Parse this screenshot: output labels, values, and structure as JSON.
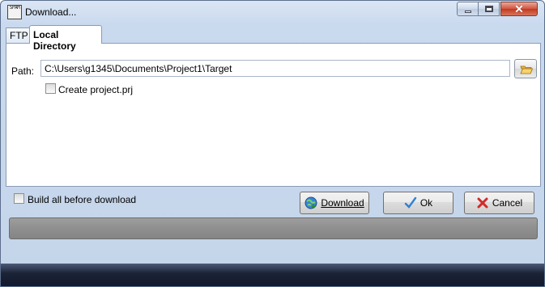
{
  "window": {
    "title": "Download...",
    "app_icon_text": "SPAM",
    "controls": {
      "minimize": "minimize-icon",
      "maximize": "maximize-icon",
      "close": "close-icon"
    }
  },
  "tabs": [
    {
      "label": "FTP",
      "active": false
    },
    {
      "label": "Local Directory",
      "active": true
    }
  ],
  "local_directory": {
    "path_label": "Path:",
    "path_value": "C:\\Users\\g1345\\Documents\\Project1\\Target",
    "browse_icon": "folder-open-icon",
    "create_project_label": "Create project.prj",
    "create_project_checked": false
  },
  "footer": {
    "build_all_label": "Build all before download",
    "build_all_checked": false,
    "download_label": "Download",
    "download_icon": "globe-download-icon",
    "ok_label": "Ok",
    "ok_icon": "checkmark-icon",
    "cancel_label": "Cancel",
    "cancel_icon": "red-x-icon",
    "progress": 0
  },
  "colors": {
    "close_button": "#c23a1f",
    "ok_check": "#2f7fd3",
    "cancel_x": "#d12a2a",
    "status_bar": "#8f8f8f"
  }
}
